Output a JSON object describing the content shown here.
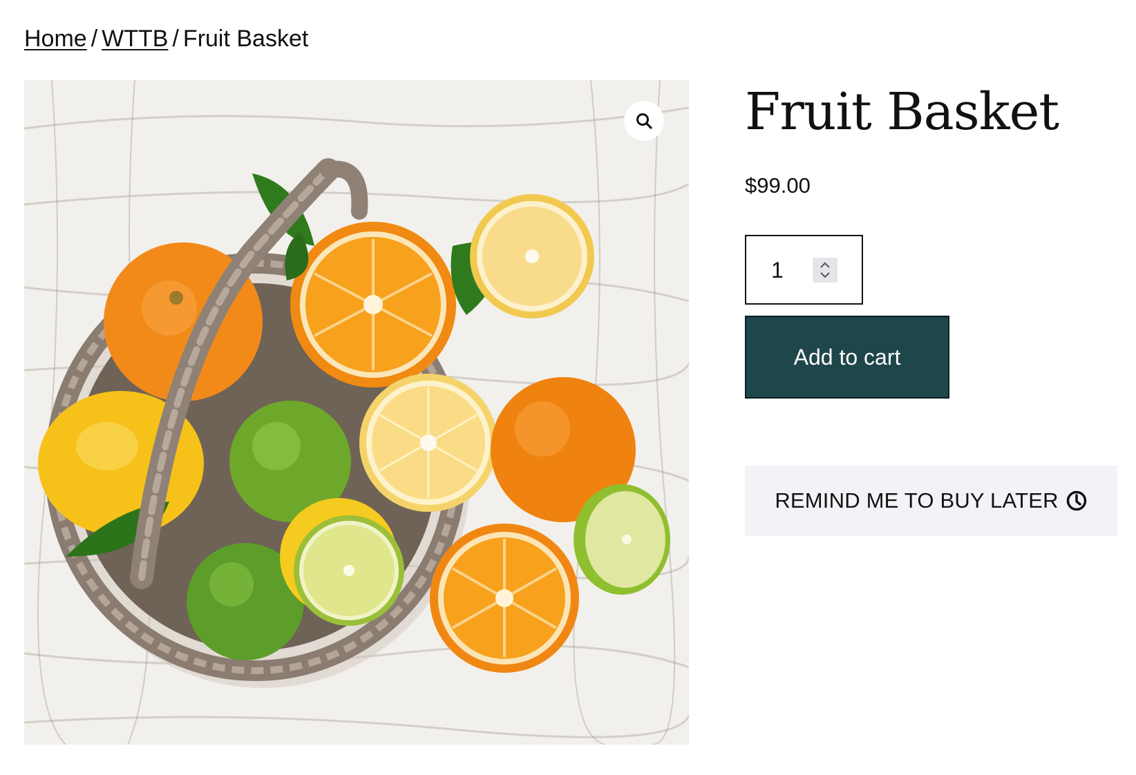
{
  "breadcrumb": {
    "items": [
      {
        "label": "Home"
      },
      {
        "label": "WTTB"
      },
      {
        "label": "Fruit Basket"
      }
    ],
    "separator": "/"
  },
  "product": {
    "title": "Fruit Basket",
    "price": "$99.00",
    "image_subject": "wicker basket of oranges, lemons and limes on white wood",
    "zoom_icon": "search-icon"
  },
  "cart": {
    "quantity": "1",
    "add_label": "Add to cart"
  },
  "remind": {
    "label": "REMIND ME TO BUY LATER",
    "icon": "clock-icon"
  },
  "colors": {
    "button_bg": "#1f474b",
    "remind_bg": "#f2f3f6",
    "text": "#111111"
  }
}
